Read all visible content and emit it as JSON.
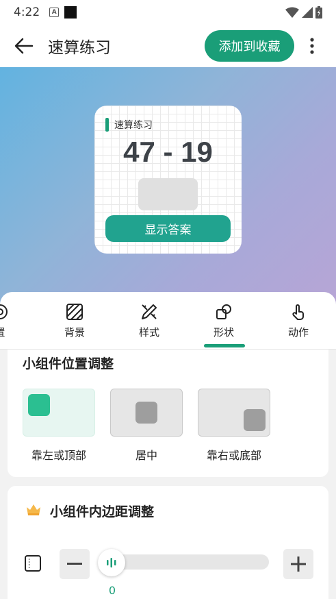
{
  "status_bar": {
    "time": "4:22",
    "badge": "A"
  },
  "app_bar": {
    "title": "速算练习",
    "favorite_label": "添加到收藏"
  },
  "widget": {
    "label": "速算练习",
    "expression": "47 - 19",
    "show_answer_label": "显示答案",
    "accent_color": "#1a9e78"
  },
  "tabs": [
    {
      "label": "置",
      "icon": "target-icon",
      "selected": false
    },
    {
      "label": "背景",
      "icon": "hatch-icon",
      "selected": false
    },
    {
      "label": "样式",
      "icon": "pencil-ruler-icon",
      "selected": false
    },
    {
      "label": "形状",
      "icon": "shapes-icon",
      "selected": true
    },
    {
      "label": "动作",
      "icon": "tap-icon",
      "selected": false
    }
  ],
  "position_card": {
    "title": "小组件位置调整",
    "options": [
      {
        "label": "靠左或顶部",
        "selected": true
      },
      {
        "label": "居中",
        "selected": false
      },
      {
        "label": "靠右或底部",
        "selected": false
      }
    ]
  },
  "padding_card": {
    "title": "小组件内边距调整",
    "value": "0"
  }
}
